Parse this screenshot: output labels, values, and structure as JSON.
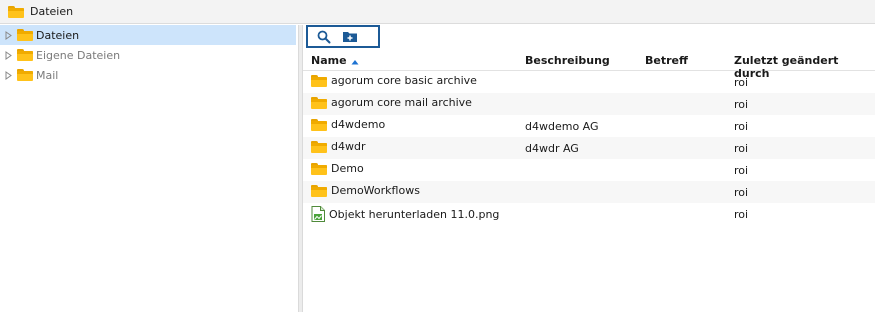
{
  "window": {
    "title": "Dateien"
  },
  "tree": {
    "items": [
      {
        "label": "Dateien",
        "selected": true,
        "dim": false
      },
      {
        "label": "Eigene Dateien",
        "selected": false,
        "dim": true
      },
      {
        "label": "Mail",
        "selected": false,
        "dim": true
      }
    ]
  },
  "toolbar": {
    "search_icon": "search-icon",
    "new_folder_icon": "new-folder-icon"
  },
  "table": {
    "columns": {
      "name": "Name",
      "beschreibung": "Beschreibung",
      "betreff": "Betreff",
      "geaendert": "Zuletzt geändert durch"
    },
    "sort": {
      "column": "name",
      "direction": "asc"
    },
    "rows": [
      {
        "type": "folder",
        "name": "agorum core basic archive",
        "beschreibung": "",
        "betreff": "",
        "geaendert": "roi"
      },
      {
        "type": "folder",
        "name": "agorum core mail archive",
        "beschreibung": "",
        "betreff": "",
        "geaendert": "roi"
      },
      {
        "type": "folder",
        "name": "d4wdemo",
        "beschreibung": "d4wdemo AG",
        "betreff": "",
        "geaendert": "roi"
      },
      {
        "type": "folder",
        "name": "d4wdr",
        "beschreibung": "d4wdr AG",
        "betreff": "",
        "geaendert": "roi"
      },
      {
        "type": "folder",
        "name": "Demo",
        "beschreibung": "",
        "betreff": "",
        "geaendert": "roi"
      },
      {
        "type": "folder",
        "name": "DemoWorkflows",
        "beschreibung": "",
        "betreff": "",
        "geaendert": "roi"
      },
      {
        "type": "file",
        "name": "Objekt herunterladen 11.0.png",
        "beschreibung": "",
        "betreff": "",
        "geaendert": "roi"
      }
    ]
  },
  "colors": {
    "accent": "#1c5a96",
    "selection": "#cde4fb",
    "folder": "#ffc21a",
    "sort_arrow": "#1e73d2"
  }
}
